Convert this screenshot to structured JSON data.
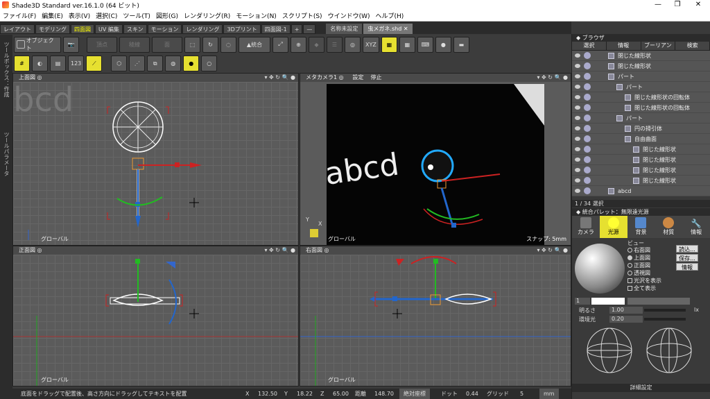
{
  "window": {
    "title": "Shade3D Standard ver.16.1.0 (64 ビット)",
    "controls": [
      "—",
      "❐",
      "✕"
    ]
  },
  "menu": [
    "ファイル(F)",
    "編集(E)",
    "表示(V)",
    "選択(C)",
    "ツール(T)",
    "図形(G)",
    "レンダリング(R)",
    "モーション(N)",
    "スクリプト(S)",
    "ウインドウ(W)",
    "ヘルプ(H)"
  ],
  "mode_tabs": [
    "レイアウト",
    "モデリング",
    "四面図",
    "UV 編集",
    "スキン",
    "モーション",
    "レンダリング",
    "3Dプリント",
    "四面図-1",
    "+",
    "—"
  ],
  "active_mode_tab": "四面図",
  "doc_tabs": [
    "名称未設定",
    "虫メガネ.shd"
  ],
  "toolbar": {
    "object": "オブジェクト",
    "vertex": "頂点",
    "edge": "稜線",
    "face": "面",
    "merge": "統合",
    "xyz": "XYZ",
    "b123": "123"
  },
  "left_strip": [
    "ツールボックス：作成",
    "ツールパラメータ"
  ],
  "viewports": {
    "top": {
      "label": "上面図",
      "corner": "グローバル",
      "bg_text": "bcd"
    },
    "camera": {
      "label": "メタカメラ1",
      "settings": "設定",
      "stop": "停止",
      "scene_text": "abcd",
      "corner": "グローバル",
      "snap": "スナップ: 5mm",
      "axis_x": "X",
      "axis_y": "Y"
    },
    "front": {
      "label": "正面図",
      "corner": "グローバル"
    },
    "right": {
      "label": "右面図",
      "corner": "グローバル"
    }
  },
  "statusbar": {
    "hint": "底面をドラッグで配置後、高さ方向にドラッグしてテキストを配置",
    "x_label": "X",
    "x": "132.50",
    "y_label": "Y",
    "y": "18.22",
    "z_label": "Z",
    "z": "65.00",
    "dist_label": "距離",
    "dist": "148.70",
    "coord": "絶対座標",
    "dot_label": "ドット",
    "dot": "0.44",
    "grid_label": "グリッド",
    "grid": "5",
    "unit": "mm"
  },
  "browser": {
    "title": "ブラウザ",
    "tabs": [
      "選択",
      "情報",
      "ブーリアン",
      "検索"
    ],
    "items": [
      {
        "label": "閉じた線形状",
        "indent": 0
      },
      {
        "label": "閉じた線形状",
        "indent": 0
      },
      {
        "label": "パート",
        "indent": 0
      },
      {
        "label": "パート",
        "indent": 1
      },
      {
        "label": "閉じた線形状の回転体",
        "indent": 2
      },
      {
        "label": "閉じた線形状の回転体",
        "indent": 2
      },
      {
        "label": "パート",
        "indent": 1
      },
      {
        "label": "円の掃引体",
        "indent": 2
      },
      {
        "label": "自由曲面",
        "indent": 2
      },
      {
        "label": "閉じた線形状",
        "indent": 3
      },
      {
        "label": "閉じた線形状",
        "indent": 3
      },
      {
        "label": "閉じた線形状",
        "indent": 3
      },
      {
        "label": "閉じた線形状",
        "indent": 3
      },
      {
        "label": "abcd",
        "indent": 0
      }
    ],
    "count": "1 / 34 選択"
  },
  "palette": {
    "title": "統合パレット：無限遠光源",
    "tabs": [
      "カメラ",
      "光源",
      "背景",
      "材質",
      "情報"
    ],
    "active_tab": "光源",
    "view_label": "ビュー",
    "views": [
      "右面図",
      "上面図",
      "正面図",
      "透視図"
    ],
    "selected_view": "上面図",
    "checks": [
      "光沢を表示",
      "全て表示"
    ],
    "buttons": [
      "読込...",
      "保存...",
      "情報"
    ],
    "num": "1",
    "brightness_label": "明るさ",
    "brightness": "1.00",
    "lx": "lx",
    "ambient_label": "環境光",
    "ambient": "0.20",
    "detail": "詳細設定"
  }
}
